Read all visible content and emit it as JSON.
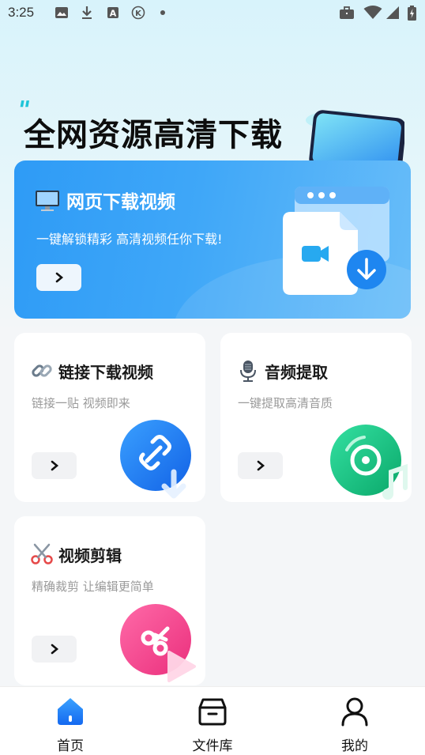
{
  "status_bar": {
    "time": "3:25",
    "icons": [
      "gallery-icon",
      "download-icon",
      "a-icon",
      "k-icon",
      "dot-icon",
      "briefcase-icon",
      "wifi-icon",
      "signal-icon",
      "battery-icon"
    ]
  },
  "hero": {
    "title": "全网资源高清下载"
  },
  "banner": {
    "title": "网页下载视频",
    "subtitle": "一键解锁精彩 高清视频任你下载!",
    "icon": "monitor-icon"
  },
  "cards": [
    {
      "title": "链接下载视频",
      "subtitle": "链接一贴 视频即来",
      "icon": "link-icon",
      "accent": "#1f7bf2"
    },
    {
      "title": "音频提取",
      "subtitle": "一键提取高清音质",
      "icon": "microphone-icon",
      "accent": "#12c67f"
    },
    {
      "title": "视频剪辑",
      "subtitle": "精确裁剪 让编辑更简单",
      "icon": "scissors-icon",
      "accent": "#f24a8e"
    }
  ],
  "tabbar": {
    "tabs": [
      {
        "label": "首页",
        "icon": "home-icon",
        "active": true
      },
      {
        "label": "文件库",
        "icon": "archive-box-icon",
        "active": false
      },
      {
        "label": "我的",
        "icon": "person-icon",
        "active": false
      }
    ]
  }
}
